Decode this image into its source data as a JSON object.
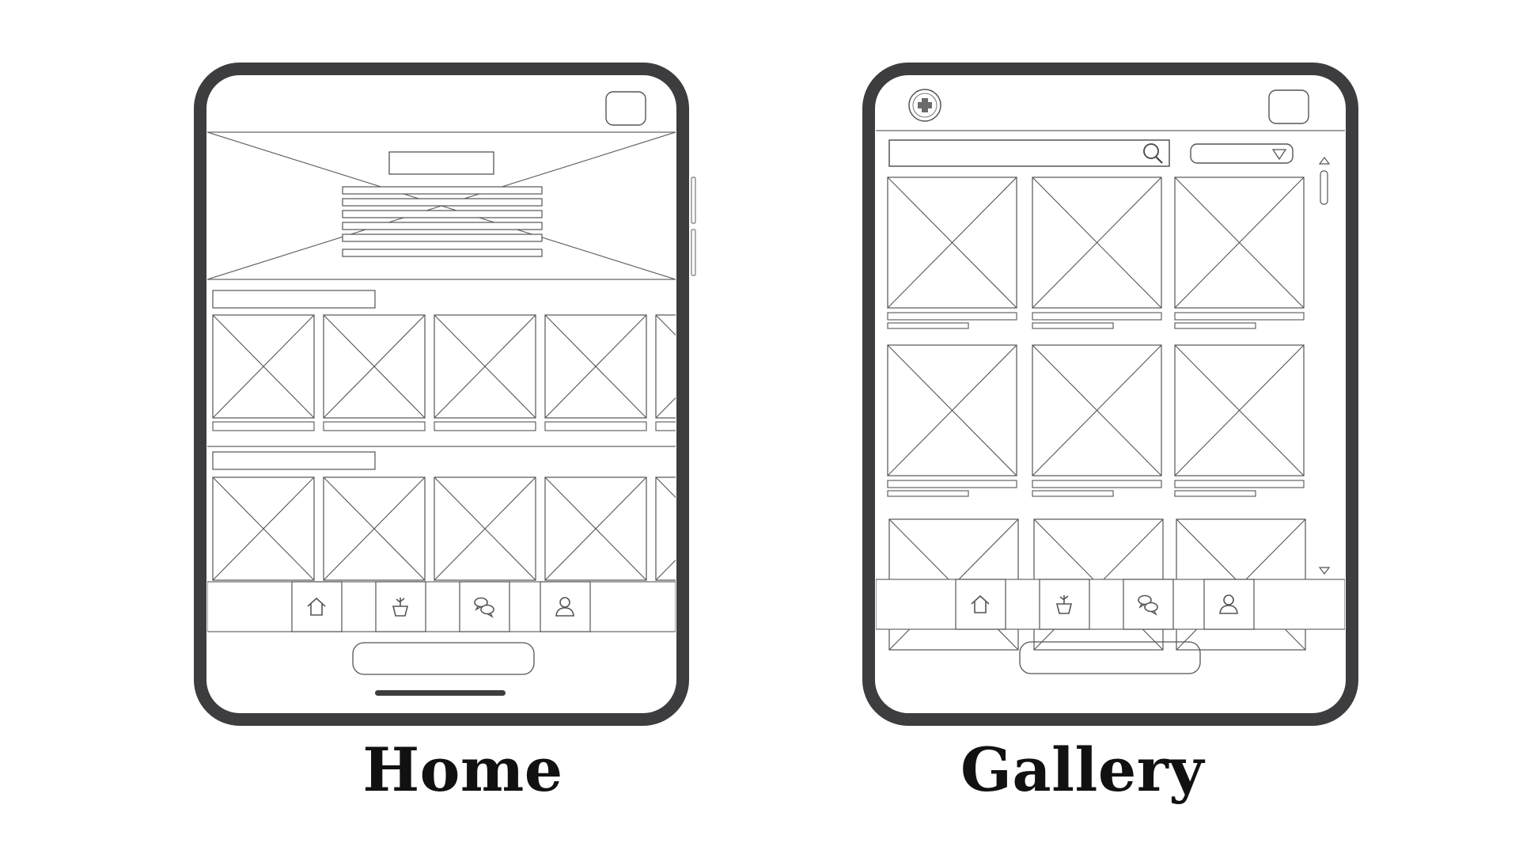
{
  "screens": [
    {
      "caption": "Home"
    },
    {
      "caption": "Gallery"
    }
  ],
  "icons": {
    "home": {
      "top_right": "square-button-icon",
      "nav": [
        "home-icon",
        "plant-icon",
        "chat-icon",
        "user-icon"
      ]
    },
    "gallery": {
      "top_left": "plus-icon",
      "top_right": "square-button-icon",
      "search": "search-icon",
      "dropdown": "triangle-down-icon",
      "scroll": [
        "scroll-up-icon",
        "scroll-down-icon"
      ],
      "nav": [
        "home-icon",
        "plant-icon",
        "chat-icon",
        "user-icon"
      ]
    }
  },
  "colors": {
    "device_frame": "#3d3d3f",
    "wire_line": "#555555",
    "background": "#ffffff"
  }
}
